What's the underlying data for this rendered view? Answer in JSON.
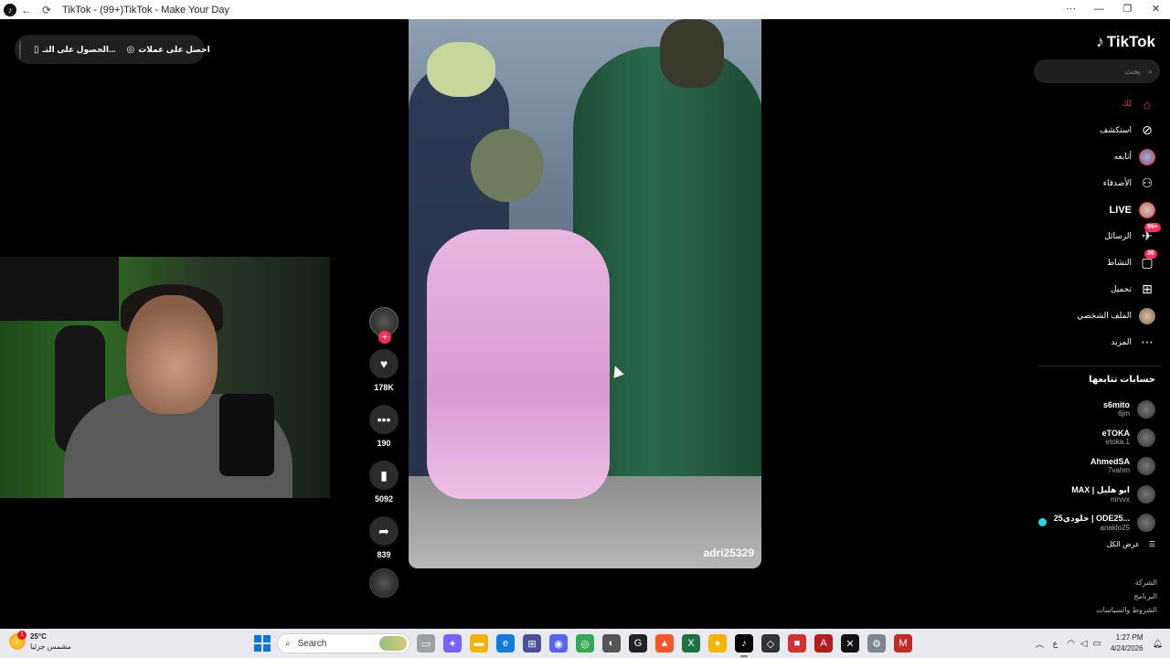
{
  "window": {
    "title": "TikTok - (99+)TikTok - Make Your Day",
    "back_icon": "←",
    "reload_icon": "⟳",
    "menu_icon": "⋯",
    "minimize_icon": "—",
    "restore_icon": "❐",
    "close_icon": "✕"
  },
  "top_left": {
    "get_coins_label": "احصل على عملات",
    "get_app_label": "الحصول على التـ..."
  },
  "video": {
    "handle": "adri25329"
  },
  "actions": {
    "like_count": "178K",
    "comment_count": "190",
    "save_count": "5092",
    "share_count": "839",
    "follow_plus": "+"
  },
  "sidebar": {
    "logo_text": "TikTok",
    "search_placeholder": "بحث",
    "nav": [
      {
        "label": "لك",
        "icon": "home-icon"
      },
      {
        "label": "استكشف",
        "icon": "compass-icon"
      },
      {
        "label": "أتابعه",
        "icon": "avatar"
      },
      {
        "label": "الأصدقاء",
        "icon": "friends-icon"
      },
      {
        "label": "LIVE",
        "icon": "live-icon"
      },
      {
        "label": "الرسائل",
        "icon": "messages-icon",
        "badge": "99+"
      },
      {
        "label": "النشاط",
        "icon": "activity-icon",
        "badge": "36"
      },
      {
        "label": "تحميل",
        "icon": "upload-icon"
      },
      {
        "label": "الملف الشخصي",
        "icon": "profile-icon"
      },
      {
        "label": "المزيد",
        "icon": "more-icon"
      }
    ],
    "following_title": "حسابات تتابعها",
    "accounts": [
      {
        "name": "s6mito",
        "username": "6jm",
        "verified": false
      },
      {
        "name": "eTOKA",
        "username": "etoka.1",
        "verified": false
      },
      {
        "name": "AhmedSA",
        "username": "7vahm",
        "verified": false
      },
      {
        "name": "MAX | ابو هليل",
        "username": "nirvvx",
        "verified": false
      },
      {
        "name": "خلودي25 | ODE25...",
        "username": "anaklo25",
        "verified": true
      }
    ],
    "see_all": "عرض الكل",
    "footer_links": [
      "الشركة",
      "البرنامج",
      "الشروط والسياسات"
    ]
  },
  "taskbar": {
    "temperature": "25°C",
    "weather_desc": "مشمس جزئيا",
    "weather_badge": "1",
    "search_label": "Search",
    "time": "1:27 PM",
    "date": "4/24/2026",
    "lang": "ع"
  }
}
